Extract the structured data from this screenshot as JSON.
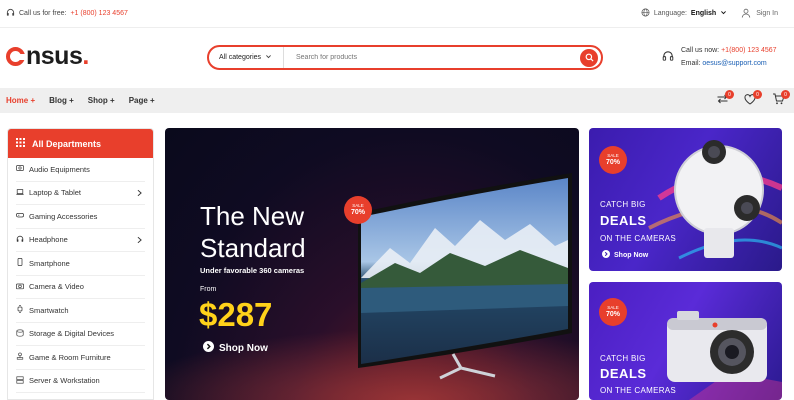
{
  "topbar": {
    "call_label": "Call us for free:",
    "call_number": "+1 (800) 123 4567",
    "language_label": "Language:",
    "language_value": "English",
    "signin": "Sign In"
  },
  "header": {
    "logo_main": "nsus",
    "logo_dot": ".",
    "search": {
      "category": "All categories",
      "placeholder": "Search for products"
    },
    "contact": {
      "call_label": "Call us now:",
      "call_number": "+1(800) 123 4567",
      "email_label": "Email:",
      "email": "oesus@support.com"
    }
  },
  "nav": {
    "items": [
      {
        "label": "Home +"
      },
      {
        "label": "Blog +"
      },
      {
        "label": "Shop +"
      },
      {
        "label": "Page +"
      }
    ],
    "compare_count": "0",
    "wishlist_count": "0",
    "cart_count": "0"
  },
  "sidebar": {
    "title": "All Departments",
    "items": [
      {
        "label": "Audio Equipments"
      },
      {
        "label": "Laptop & Tablet"
      },
      {
        "label": "Gaming Accessories"
      },
      {
        "label": "Headphone"
      },
      {
        "label": "Smartphone"
      },
      {
        "label": "Camera & Video"
      },
      {
        "label": "Smartwatch"
      },
      {
        "label": "Storage & Digital Devices"
      },
      {
        "label": "Game & Room Furniture"
      },
      {
        "label": "Server & Workstation"
      }
    ]
  },
  "hero": {
    "title_line1": "The New",
    "title_line2": "Standard",
    "subtitle": "Under favorable 360 cameras",
    "from_label": "From",
    "price": "$287",
    "cta": "Shop Now",
    "sale_label": "SALE",
    "sale_value": "70%"
  },
  "banners": [
    {
      "sale_label": "SALE",
      "sale_value": "70%",
      "line1": "CATCH BIG",
      "line2": "DEALS",
      "line3": "ON THE CAMERAS",
      "cta": "Shop Now"
    },
    {
      "sale_label": "SALE",
      "sale_value": "70%",
      "line1": "CATCH BIG",
      "line2": "DEALS",
      "line3": "ON THE CAMERAS"
    }
  ],
  "colors": {
    "accent": "#e83f2c",
    "price": "#ffd21a",
    "banner": "#4a26c9"
  }
}
